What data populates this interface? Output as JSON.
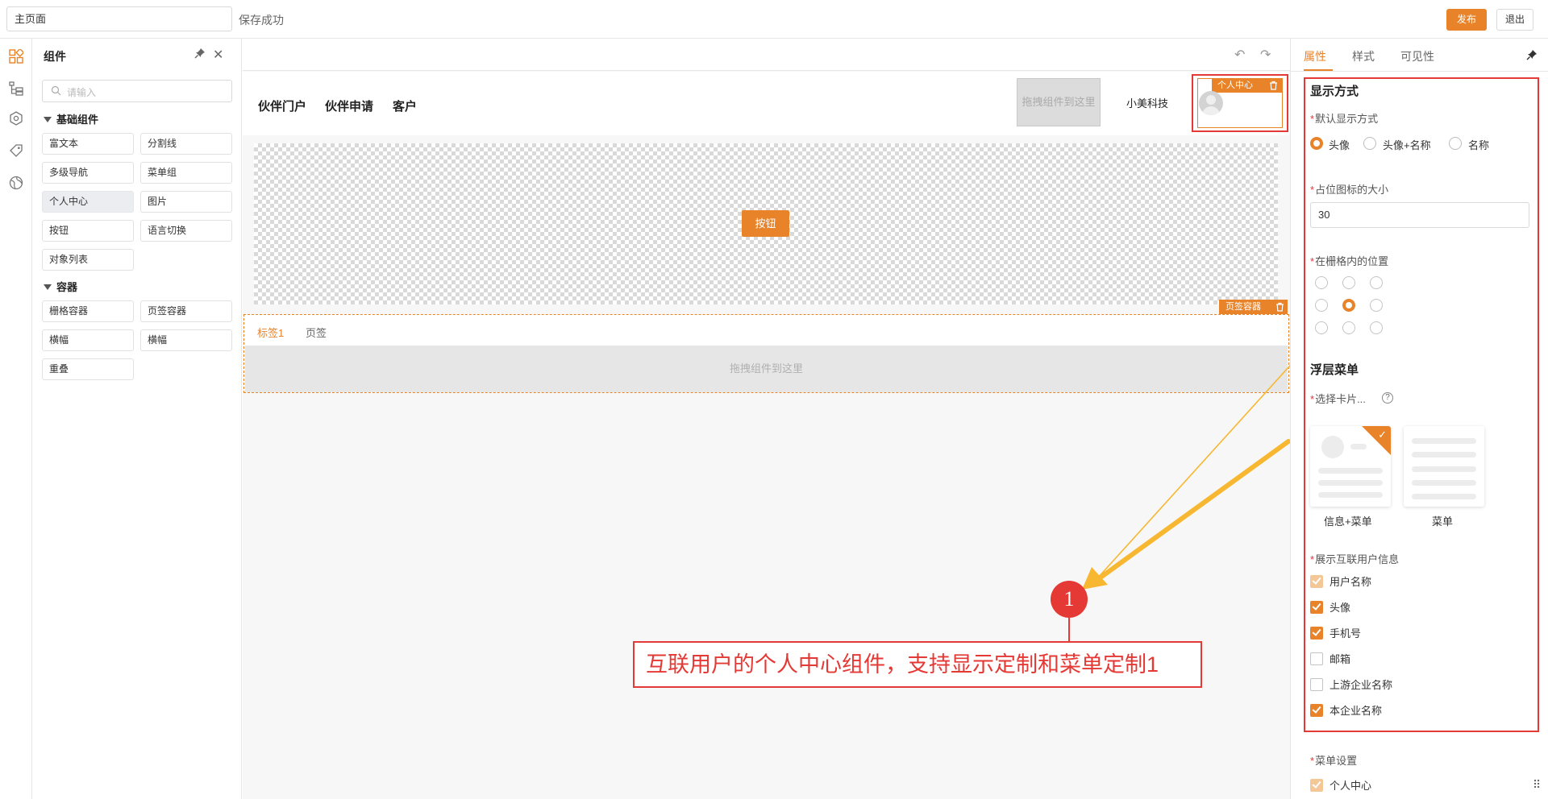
{
  "topbar": {
    "page_name": "主页面",
    "save_status": "保存成功",
    "publish_label": "发布",
    "exit_label": "退出"
  },
  "rail": {
    "icons": [
      "components-icon",
      "tree-icon",
      "settings-icon",
      "tag-icon",
      "globe-icon"
    ]
  },
  "components_panel": {
    "title": "组件",
    "search_placeholder": "请输入",
    "groups": [
      {
        "title": "基础组件",
        "items": [
          "富文本",
          "分割线",
          "多级导航",
          "菜单组",
          "个人中心",
          "图片",
          "按钮",
          "语言切换",
          "对象列表"
        ]
      },
      {
        "title": "容器",
        "items": [
          "栅格容器",
          "页签容器",
          "横幅",
          "横幅",
          "重叠"
        ]
      }
    ],
    "active_item": "个人中心"
  },
  "canvas": {
    "nav": [
      "伙伴门户",
      "伙伴申请",
      "客户"
    ],
    "drop_zone_small": "拖拽组件到这里",
    "company": "小美科技",
    "personal_center_tag": "个人中心",
    "banner_button": "按钮",
    "tab_container_tag": "页签容器",
    "tabs": [
      "标签1",
      "页签"
    ],
    "tab_drop": "拖拽组件到这里"
  },
  "annotation": {
    "number": "1",
    "text": "互联用户的个人中心组件，支持显示定制和菜单定制1"
  },
  "right_panel": {
    "tabs": [
      "属性",
      "样式",
      "可见性"
    ],
    "active_tab": "属性",
    "display_section": "显示方式",
    "default_display_label": "默认显示方式",
    "display_options": [
      "头像",
      "头像+名称",
      "名称"
    ],
    "display_selected": "头像",
    "placeholder_size_label": "占位图标的大小",
    "placeholder_size_value": "30",
    "grid_position_label": "在栅格内的位置",
    "grid_position_selected": "middle-center",
    "float_menu_section": "浮层菜单",
    "select_card_label": "选择卡片...",
    "cards": [
      "信息+菜单",
      "菜单"
    ],
    "card_selected": "信息+菜单",
    "show_info_label": "展示互联用户信息",
    "info_options": [
      {
        "label": "用户名称",
        "checked": true,
        "disabled": true
      },
      {
        "label": "头像",
        "checked": true,
        "disabled": false
      },
      {
        "label": "手机号",
        "checked": true,
        "disabled": false
      },
      {
        "label": "邮箱",
        "checked": false,
        "disabled": false
      },
      {
        "label": "上游企业名称",
        "checked": false,
        "disabled": false
      },
      {
        "label": "本企业名称",
        "checked": true,
        "disabled": false
      }
    ],
    "menu_settings_label": "菜单设置",
    "menu_items": [
      {
        "label": "个人中心",
        "checked": true,
        "disabled": true
      }
    ]
  },
  "colors": {
    "accent": "#e8832a",
    "highlight_red": "#e53935",
    "arrow_yellow": "#f7b731"
  }
}
